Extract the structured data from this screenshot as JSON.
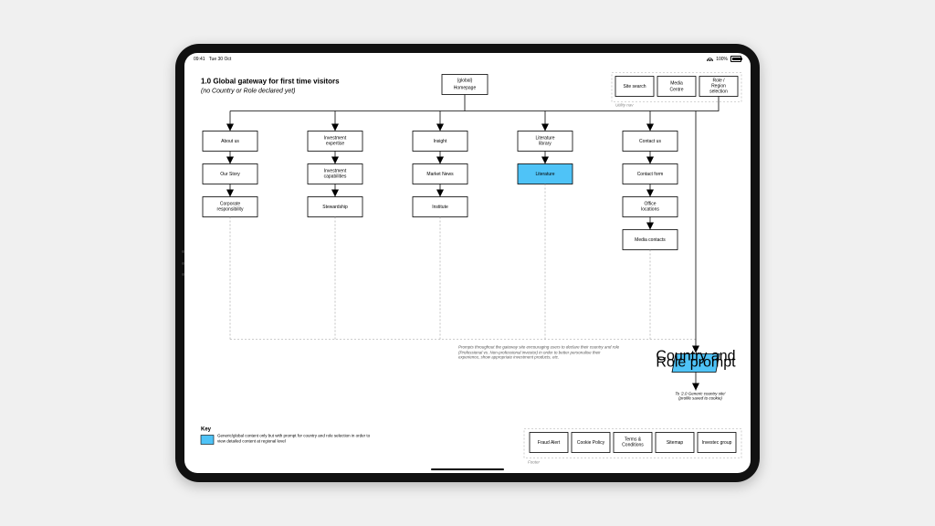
{
  "statusbar": {
    "time": "09:41",
    "date": "Tue 30 Oct",
    "battery": "100%"
  },
  "title": {
    "line1": "1.0 Global gateway for first time visitors",
    "line2": "(no Country or Role declared yet)"
  },
  "root": {
    "l1": "{global}",
    "l2": "Homepage"
  },
  "utility": {
    "label": "Utility nav",
    "items": [
      "Site search",
      "Media Centre",
      "Role / Region selection"
    ]
  },
  "cols": [
    {
      "head": "About us",
      "kids": [
        "Our Story",
        "Corporate responsibility"
      ]
    },
    {
      "head": "Investment expertise",
      "kids": [
        "Investment capabilities",
        "Stewardship"
      ]
    },
    {
      "head": "Insight",
      "kids": [
        "Market News",
        "Institute"
      ]
    },
    {
      "head": "Literature library",
      "kids": [
        "Literature"
      ],
      "hl": [
        0
      ]
    },
    {
      "head": "Contact us",
      "kids": [
        "Contact form",
        "Office locations",
        "Media contacts"
      ]
    }
  ],
  "prompt_note": "Prompts throughout the gateway site encouraging users to declare their country and role (Professional vs. Non-professional investor) in order to better personalise their experience, show appropriate investment products, etc.",
  "prompt_box": "Country and Role prompt",
  "prompt_dest": "To '2.0 Generic country site' (profile saved to cookie)",
  "key": {
    "title": "Key",
    "text": "Generic/global content only but with prompt for country and role selection in order to view detailed content at regional level"
  },
  "footer": {
    "label": "Footer",
    "items": [
      "Fraud Alert",
      "Cookie Policy",
      "Terms & Conditions",
      "Sitemap",
      "Investec group"
    ]
  }
}
